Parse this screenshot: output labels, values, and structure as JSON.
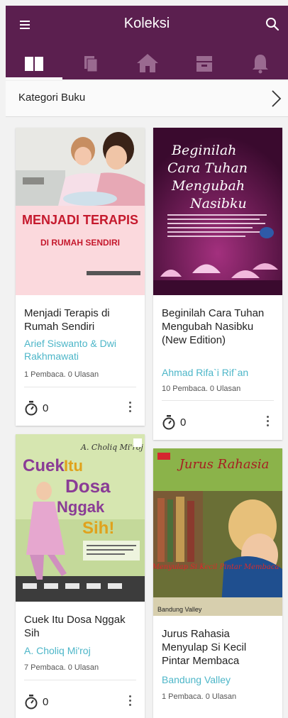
{
  "header": {
    "title": "Koleksi",
    "background": "#5b1f4f",
    "tabs": [
      {
        "icon": "book-open-icon",
        "active": true
      },
      {
        "icon": "bookshelf-icon",
        "active": false
      },
      {
        "icon": "home-icon",
        "active": false
      },
      {
        "icon": "archive-icon",
        "active": false
      },
      {
        "icon": "bell-icon",
        "active": false
      }
    ]
  },
  "category": {
    "label": "Kategori Buku"
  },
  "books": [
    {
      "cover_title": "MENJADI TERAPIS",
      "cover_subtitle": "DI RUMAH SENDIRI",
      "title": "Menjadi Terapis di Rumah Sendiri",
      "author": "Arief Siswanto & Dwi Rakhmawati",
      "stats": "1 Pembaca. 0 Ulasan",
      "reading_time": "0"
    },
    {
      "cover_title": "Beginilah Cara Tuhan Mengubah Nasibku",
      "title": "Beginilah Cara Tuhan Mengubah Nasibku (New Edition)",
      "author": "Ahmad Rifa`i Rif`an",
      "stats": "10 Pembaca. 0 Ulasan",
      "reading_time": "0"
    },
    {
      "cover_author": "A. Choliq Mi'roj",
      "cover_title": "Cuek Itu Dosa Nggak Sih!",
      "title": "Cuek Itu Dosa Nggak Sih",
      "author": "A. Choliq Mi'roj",
      "stats": "7 Pembaca. 0 Ulasan",
      "reading_time": "0"
    },
    {
      "cover_title_top": "Jurus Rahasia",
      "cover_title_bottom": "Menyulap Si Kecil Pintar Membaca",
      "cover_author": "Bandung Valley",
      "title": "Jurus Rahasia Menyulap Si Kecil Pintar Membaca",
      "author": "Bandung Valley",
      "stats": "1 Pembaca. 0 Ulasan"
    }
  ]
}
